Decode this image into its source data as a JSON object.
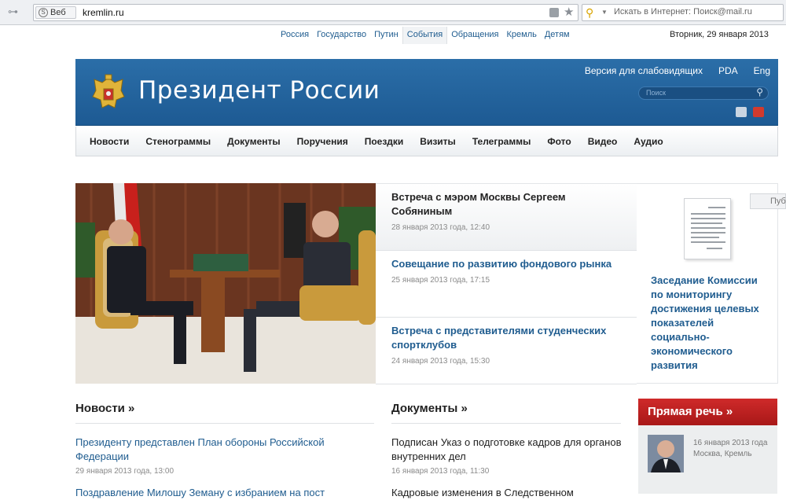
{
  "browser": {
    "web_tab": "Веб",
    "url": "kremlin.ru",
    "search_placeholder": "Искать в Интернет: Поиск@mail.ru"
  },
  "top_nav": {
    "items": [
      "Россия",
      "Государство",
      "Путин",
      "События",
      "Обращения",
      "Кремль",
      "Детям"
    ],
    "active_index": 3,
    "date": "Вторник, 29 января 2013"
  },
  "banner": {
    "title": "Президент России",
    "links": [
      "Версия для слабовидящих",
      "PDA",
      "Eng"
    ],
    "search_placeholder": "Поиск"
  },
  "main_menu": [
    "Новости",
    "Стенограммы",
    "Документы",
    "Поручения",
    "Поездки",
    "Визиты",
    "Телеграммы",
    "Фото",
    "Видео",
    "Аудио"
  ],
  "feed": [
    {
      "title": "Встреча с мэром Москвы Сергеем Собяниным",
      "date": "28 января 2013 года, 12:40"
    },
    {
      "title": "Совещание по развитию фондового рынка",
      "date": "25 января 2013 года, 17:15"
    },
    {
      "title": "Встреча с представителями студенческих спортклубов",
      "date": "24 января 2013 года, 15:30"
    }
  ],
  "featured_doc": {
    "title": "Заседание Комиссии по мониторингу достижения целевых показателей социально-экономического развития"
  },
  "pub_tab": "Пуб",
  "news": {
    "heading": "Новости »",
    "items": [
      {
        "title": "Президенту представлен План обороны Российской Федерации",
        "date": "29 января 2013 года, 13:00"
      },
      {
        "title": "Поздравление Милошу Земану с избранием на пост"
      }
    ]
  },
  "documents": {
    "heading": "Документы »",
    "items": [
      {
        "title": "Подписан Указ о подготовке кадров для органов внутренних дел",
        "date": "16 января 2013 года, 11:30"
      },
      {
        "title": "Кадровые изменения в Следственном"
      }
    ]
  },
  "direct_speech": {
    "heading": "Прямая речь »",
    "date": "16 января 2013 года",
    "place": "Москва, Кремль"
  },
  "colors": {
    "banner_blue": "#1d5a93",
    "link_blue": "#1f5c8f",
    "speech_red": "#b81f1f"
  }
}
